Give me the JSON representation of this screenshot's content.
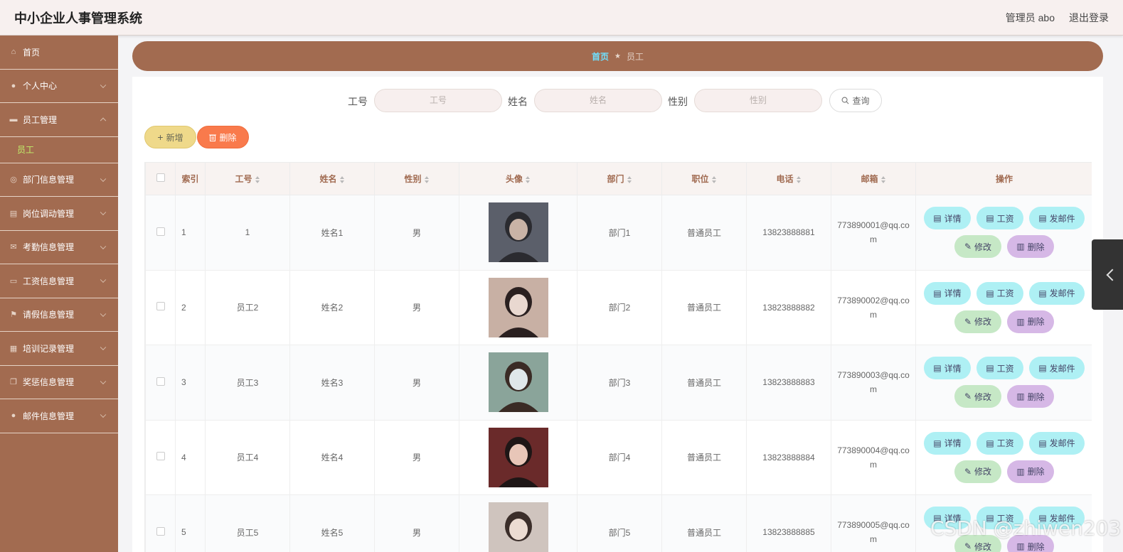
{
  "header": {
    "title": "中小企业人事管理系统",
    "user": "管理员 abo",
    "logout": "退出登录"
  },
  "sidebar": {
    "items": [
      {
        "label": "首页",
        "icon": "home-icon"
      },
      {
        "label": "个人中心",
        "icon": "user-icon",
        "chevron": "down"
      },
      {
        "label": "员工管理",
        "icon": "briefcase-icon",
        "chevron": "up"
      },
      {
        "label": "部门信息管理",
        "icon": "globe-icon",
        "chevron": "down"
      },
      {
        "label": "岗位调动管理",
        "icon": "clipboard-icon",
        "chevron": "down"
      },
      {
        "label": "考勤信息管理",
        "icon": "mail-icon",
        "chevron": "down"
      },
      {
        "label": "工资信息管理",
        "icon": "chat-icon",
        "chevron": "down"
      },
      {
        "label": "请假信息管理",
        "icon": "flag-icon",
        "chevron": "down"
      },
      {
        "label": "培训记录管理",
        "icon": "document-icon",
        "chevron": "down"
      },
      {
        "label": "奖惩信息管理",
        "icon": "copy-icon",
        "chevron": "down"
      },
      {
        "label": "邮件信息管理",
        "icon": "user-icon",
        "chevron": "down"
      }
    ],
    "sub_item": "员工"
  },
  "breadcrumb": {
    "home": "首页",
    "separator": "★",
    "current": "员工"
  },
  "search": {
    "fields": [
      {
        "label": "工号",
        "placeholder": "工号"
      },
      {
        "label": "姓名",
        "placeholder": "姓名"
      },
      {
        "label": "性别",
        "placeholder": "性别"
      }
    ],
    "query_label": "查询"
  },
  "actions": {
    "add_label": "新增",
    "delete_label": "删除"
  },
  "table": {
    "headers": [
      "索引",
      "工号",
      "姓名",
      "性别",
      "头像",
      "部门",
      "职位",
      "电话",
      "邮箱",
      "操作"
    ],
    "rows": [
      {
        "index": "1",
        "id": "1",
        "name": "姓名1",
        "gender": "男",
        "dept": "部门1",
        "position": "普通员工",
        "phone": "13823888881",
        "email": "773890001@qq.com"
      },
      {
        "index": "2",
        "id": "员工2",
        "name": "姓名2",
        "gender": "男",
        "dept": "部门2",
        "position": "普通员工",
        "phone": "13823888882",
        "email": "773890002@qq.com"
      },
      {
        "index": "3",
        "id": "员工3",
        "name": "姓名3",
        "gender": "男",
        "dept": "部门3",
        "position": "普通员工",
        "phone": "13823888883",
        "email": "773890003@qq.com"
      },
      {
        "index": "4",
        "id": "员工4",
        "name": "姓名4",
        "gender": "男",
        "dept": "部门4",
        "position": "普通员工",
        "phone": "13823888884",
        "email": "773890004@qq.com"
      },
      {
        "index": "5",
        "id": "员工5",
        "name": "姓名5",
        "gender": "男",
        "dept": "部门5",
        "position": "普通员工",
        "phone": "13823888885",
        "email": "773890005@qq.com"
      }
    ],
    "ops": {
      "detail": "详情",
      "salary": "工资",
      "mail": "发邮件",
      "edit": "修改",
      "remove": "删除"
    }
  },
  "watermark": "CSDN @zhiwen203",
  "colors": {
    "sidebar": "#a26b50",
    "header_bg": "#f7f0ef",
    "active_sub": "#c2f06a",
    "crumb_home": "#6fe0ff",
    "add_button": "#efd98a",
    "delete_button": "#f97a4c",
    "op_cyan": "#aef0f4",
    "op_green": "#c6e8c6",
    "op_purple": "#d6b8e6"
  }
}
